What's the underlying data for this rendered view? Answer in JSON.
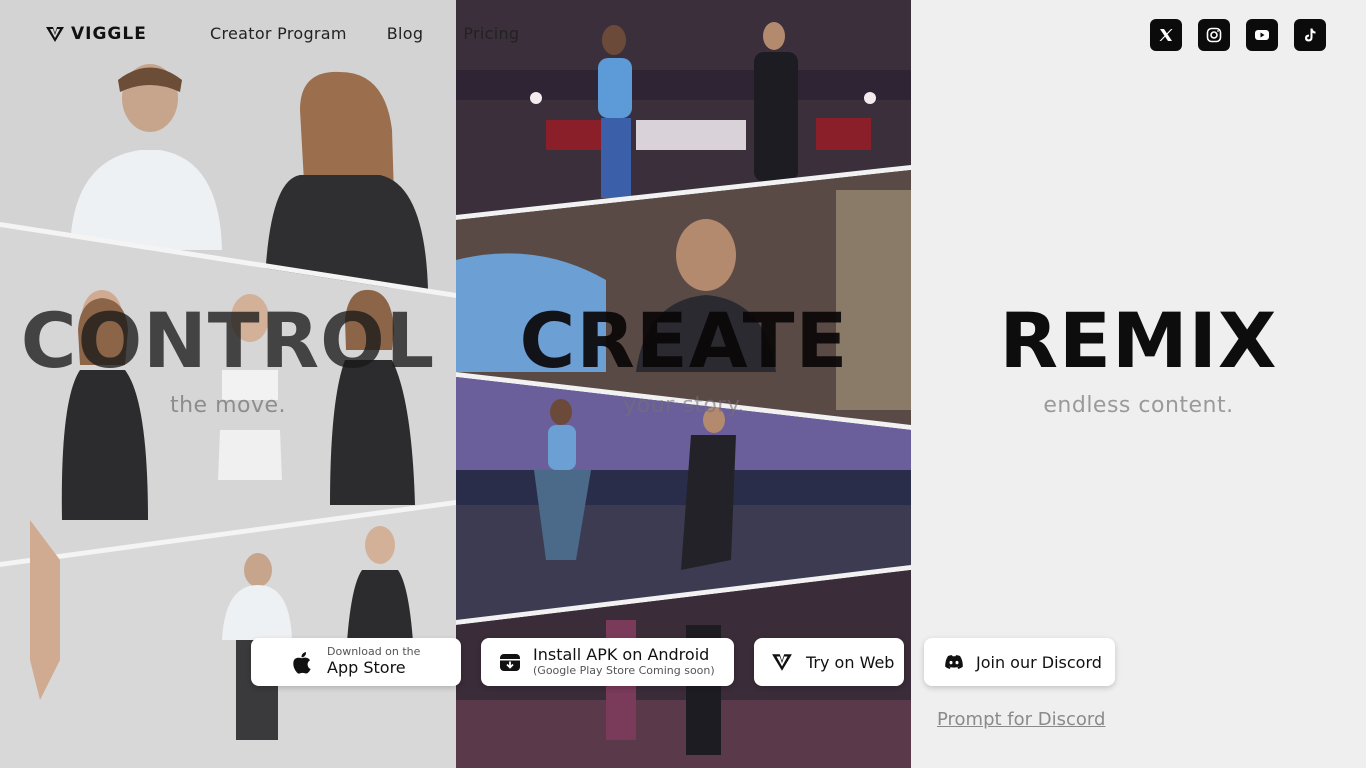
{
  "brand": {
    "name": "VIGGLE"
  },
  "nav": {
    "items": [
      {
        "label": "Creator Program"
      },
      {
        "label": "Blog"
      },
      {
        "label": "Pricing"
      }
    ]
  },
  "socials": [
    {
      "icon": "x-icon"
    },
    {
      "icon": "instagram-icon"
    },
    {
      "icon": "youtube-icon"
    },
    {
      "icon": "tiktok-icon"
    }
  ],
  "hero": {
    "control": {
      "title": "CONTROL",
      "subtitle": "the move."
    },
    "create": {
      "title": "CREATE",
      "subtitle": "your story."
    },
    "remix": {
      "title": "REMIX",
      "subtitle": "endless content."
    }
  },
  "cta": {
    "appstore": {
      "small": "Download on the",
      "main": "App Store",
      "icon": "apple-icon"
    },
    "apk": {
      "main": "Install APK on Android",
      "note": "(Google Play Store Coming soon)",
      "icon": "download-icon"
    },
    "web": {
      "label": "Try on Web",
      "icon": "viggle-logo-icon"
    },
    "discord": {
      "label": "Join our Discord",
      "icon": "discord-icon"
    }
  },
  "prompt_link": {
    "label": "Prompt for Discord"
  },
  "colors": {
    "background": "#efefef",
    "button_bg": "#ffffff",
    "social_bg": "#0b0b0b",
    "text": "#111111"
  }
}
